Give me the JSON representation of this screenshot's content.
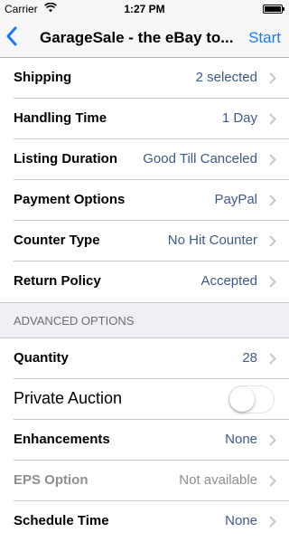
{
  "status_bar": {
    "carrier": "Carrier",
    "time": "1:27 PM"
  },
  "nav": {
    "title": "GarageSale - the eBay to...",
    "start_label": "Start",
    "back_icon": "chevron-left-icon",
    "accent_color": "#1a7cf5"
  },
  "rows_top": [
    {
      "label": "Shipping",
      "value": "2 selected"
    },
    {
      "label": "Handling Time",
      "value": "1 Day"
    },
    {
      "label": "Listing Duration",
      "value": "Good Till Canceled"
    },
    {
      "label": "Payment Options",
      "value": "PayPal"
    },
    {
      "label": "Counter Type",
      "value": "No Hit Counter"
    },
    {
      "label": "Return Policy",
      "value": "Accepted"
    }
  ],
  "advanced": {
    "header": "ADVANCED OPTIONS",
    "quantity": {
      "label": "Quantity",
      "value": "28"
    },
    "private_auction": {
      "label": "Private Auction",
      "enabled": false
    },
    "enhancements": {
      "label": "Enhancements",
      "value": "None"
    },
    "eps_option": {
      "label": "EPS Option",
      "value": "Not available"
    },
    "schedule_time": {
      "label": "Schedule Time",
      "value": "None"
    }
  }
}
